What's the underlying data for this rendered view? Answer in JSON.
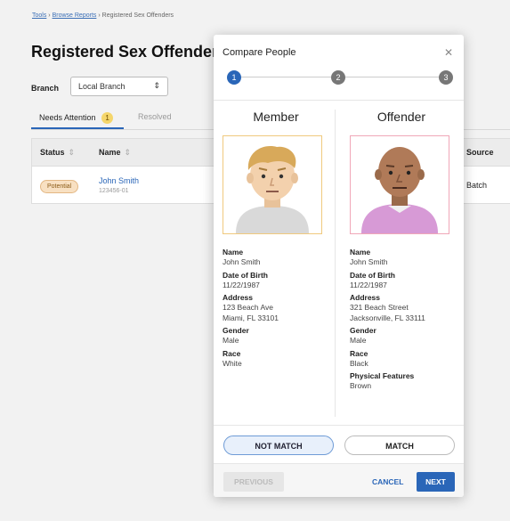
{
  "breadcrumb": {
    "items": [
      "Tools",
      "Browse Reports",
      "Registered Sex Offenders"
    ],
    "separator": "›"
  },
  "page": {
    "title": "Registered Sex Offenders",
    "branch_label": "Branch",
    "branch_value": "Local Branch"
  },
  "tabs": [
    {
      "label": "Needs Attention",
      "count": "1"
    },
    {
      "label": "Resolved"
    }
  ],
  "table": {
    "headers": [
      "Status",
      "Name",
      "Source"
    ],
    "rows": [
      {
        "status": "Potential",
        "name": "John Smith",
        "id": "123456-01",
        "source": "Batch"
      }
    ]
  },
  "modal": {
    "title": "Compare People",
    "close_icon": "close-icon",
    "steps": [
      "1",
      "2",
      "3"
    ],
    "active_step": 1,
    "member": {
      "heading": "Member",
      "fields": [
        {
          "label": "Name",
          "values": [
            "John Smith"
          ]
        },
        {
          "label": "Date of Birth",
          "values": [
            "11/22/1987"
          ]
        },
        {
          "label": "Address",
          "values": [
            "123 Beach Ave",
            "Miami, FL 33101"
          ]
        },
        {
          "label": "Gender",
          "values": [
            "Male"
          ]
        },
        {
          "label": "Race",
          "values": [
            "White"
          ]
        }
      ]
    },
    "offender": {
      "heading": "Offender",
      "fields": [
        {
          "label": "Name",
          "values": [
            "John Smith"
          ]
        },
        {
          "label": "Date of Birth",
          "values": [
            "11/22/1987"
          ]
        },
        {
          "label": "Address",
          "values": [
            "321 Beach Street",
            "Jacksonville, FL 33111"
          ]
        },
        {
          "label": "Gender",
          "values": [
            "Male"
          ]
        },
        {
          "label": "Race",
          "values": [
            "Black"
          ]
        },
        {
          "label": "Physical Features",
          "values": [
            "Brown"
          ]
        }
      ]
    },
    "buttons": {
      "not_match": "NOT MATCH",
      "match": "MATCH",
      "previous": "PREVIOUS",
      "cancel": "CANCEL",
      "next": "NEXT"
    }
  },
  "colors": {
    "accent": "#2a66b8",
    "potential_badge": "#f8e0c2",
    "member_photo_border": "#f0c97e",
    "offender_photo_border": "#f0a7b8"
  }
}
